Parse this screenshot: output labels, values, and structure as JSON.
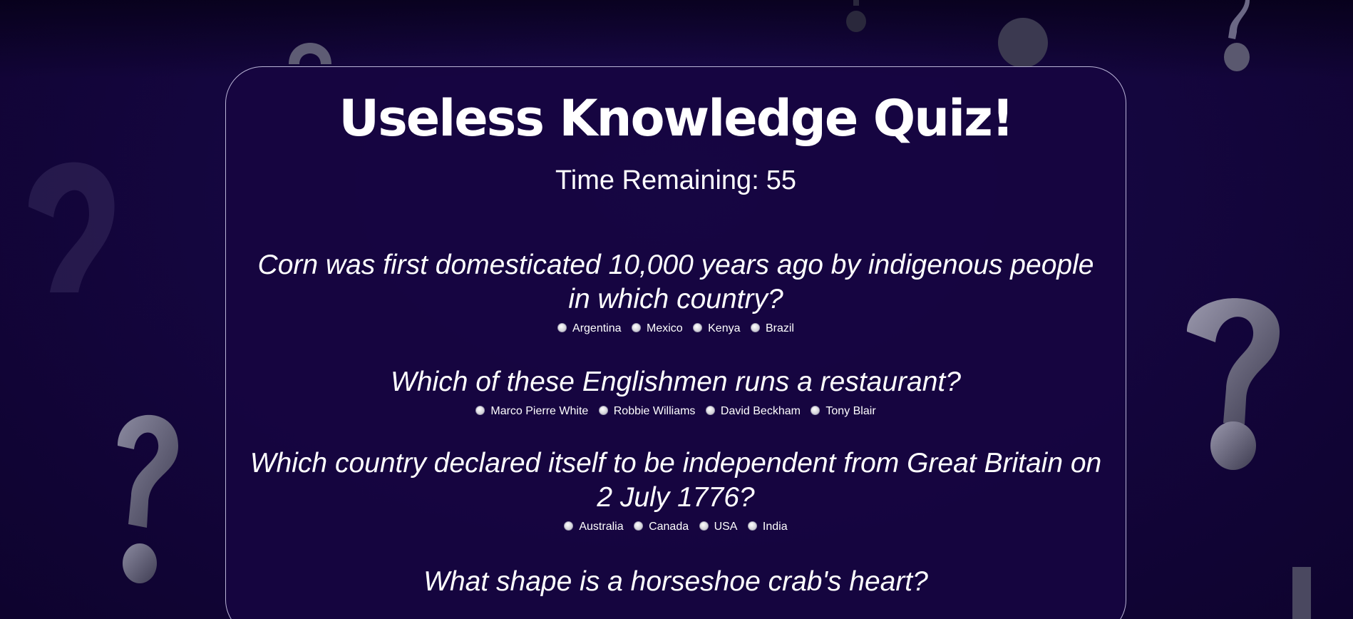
{
  "title": "Useless Knowledge Quiz!",
  "timer": {
    "label": "Time Remaining:",
    "value": "55"
  },
  "questions": [
    {
      "text": "Corn was first domesticated 10,000 years ago by indigenous people in which country?",
      "options": [
        "Argentina",
        "Mexico",
        "Kenya",
        "Brazil"
      ]
    },
    {
      "text": "Which of these Englishmen runs a restaurant?",
      "options": [
        "Marco Pierre White",
        "Robbie Williams",
        "David Beckham",
        "Tony Blair"
      ]
    },
    {
      "text": "Which country declared itself to be independent from Great Britain on 2 July 1776?",
      "options": [
        "Australia",
        "Canada",
        "USA",
        "India"
      ]
    },
    {
      "text": "What shape is a horseshoe crab's heart?",
      "options": []
    }
  ],
  "background": {
    "icon": "question-mark-icon",
    "color": "#150640",
    "accent": "#6b6885"
  }
}
